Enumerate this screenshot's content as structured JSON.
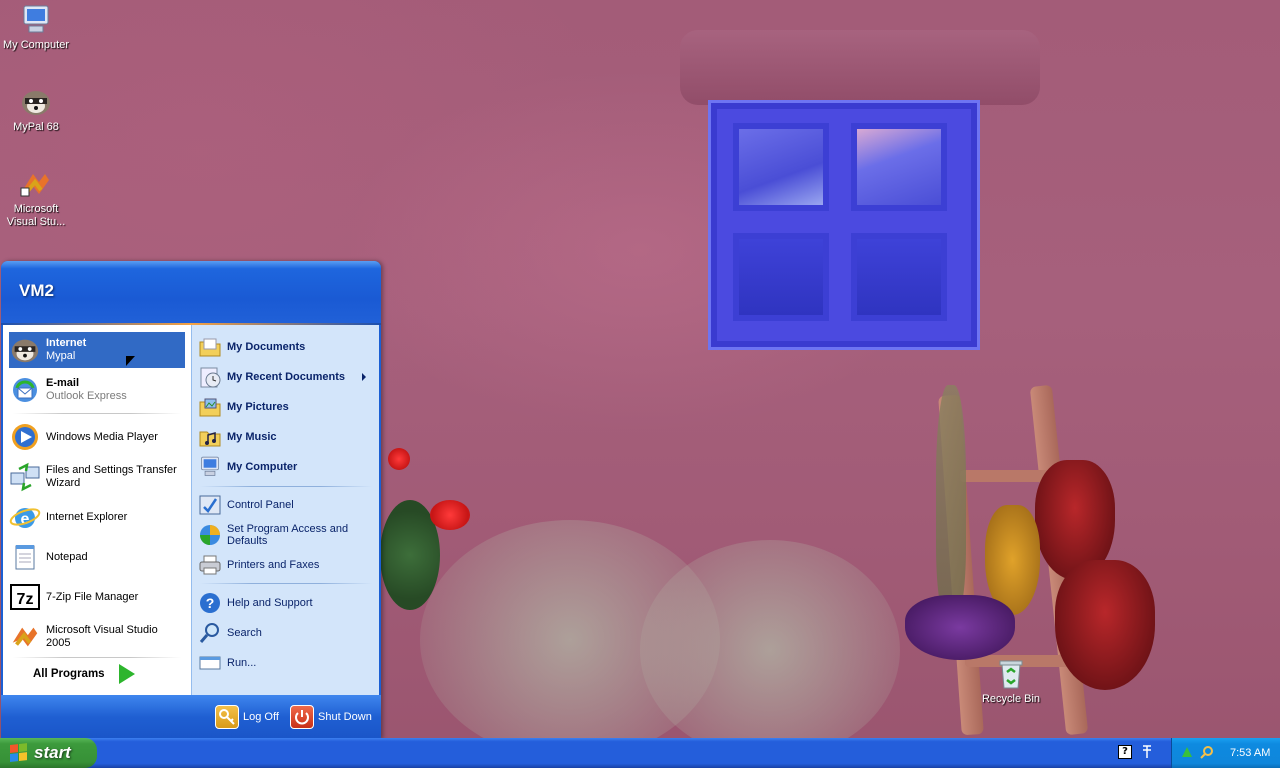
{
  "desktop": {
    "icons": [
      {
        "label": "My Computer"
      },
      {
        "label": "MyPal 68"
      },
      {
        "label": "Microsoft Visual Stu..."
      },
      {
        "label": "Recycle Bin"
      }
    ]
  },
  "start_menu": {
    "user_name": "VM2",
    "pinned": [
      {
        "title": "Internet",
        "subtitle": "Mypal"
      },
      {
        "title": "E-mail",
        "subtitle": "Outlook Express"
      }
    ],
    "recent": [
      "Windows Media Player",
      "Files and Settings Transfer Wizard",
      "Internet Explorer",
      "Notepad",
      "7-Zip File Manager",
      "Microsoft Visual Studio 2005"
    ],
    "all_programs": "All Programs",
    "places": [
      "My Documents",
      "My Recent Documents",
      "My Pictures",
      "My Music",
      "My Computer"
    ],
    "system": [
      "Control Panel",
      "Set Program Access and Defaults",
      "Printers and Faxes"
    ],
    "tools": [
      "Help and Support",
      "Search",
      "Run..."
    ],
    "log_off": "Log Off",
    "shut_down": "Shut Down"
  },
  "taskbar": {
    "start_label": "start",
    "clock": "7:53 AM"
  },
  "colors": {
    "taskbar": "#245edb",
    "start_button": "#379137",
    "highlight": "#316ac5",
    "menu_right_panel": "#d3e5fa"
  }
}
